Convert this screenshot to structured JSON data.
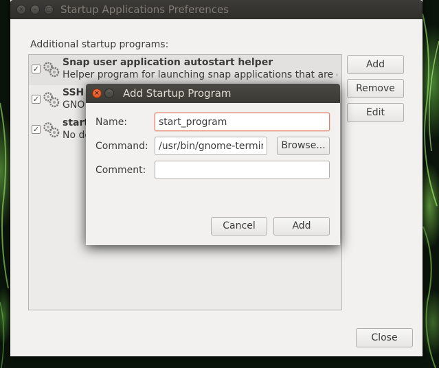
{
  "main_window": {
    "title": "Startup Applications Preferences",
    "section_label": "Additional startup programs:",
    "items": [
      {
        "name": "Snap user application autostart helper",
        "description": "Helper program for launching snap applications that are c...",
        "checked": true,
        "selected": true
      },
      {
        "name": "SSH",
        "description": "GNO",
        "checked": true,
        "selected": false
      },
      {
        "name": "start",
        "description": "No de",
        "checked": true,
        "selected": false
      }
    ],
    "buttons": {
      "add": "Add",
      "remove": "Remove",
      "edit": "Edit",
      "close": "Close"
    },
    "window_controls": {
      "close": "×",
      "minimize": "–",
      "maximize": "□"
    }
  },
  "dialog": {
    "title": "Add Startup Program",
    "name_label": "Name:",
    "name_value": "start_program",
    "command_label": "Command:",
    "command_value": "/usr/bin/gnome-terminal",
    "browse_label": "Browse...",
    "comment_label": "Comment:",
    "comment_value": "",
    "cancel_label": "Cancel",
    "add_label": "Add",
    "window_controls": {
      "close": "×",
      "minimize": "–"
    }
  },
  "colors": {
    "accent_focus": "#e3806a",
    "close_button": "#dd4814",
    "titlebar": "#3c3b37",
    "window_bg": "#f2f1f0"
  },
  "icons": [
    "checkbox-checked-icon",
    "gear-icon",
    "close-icon",
    "minimize-icon",
    "maximize-icon"
  ]
}
